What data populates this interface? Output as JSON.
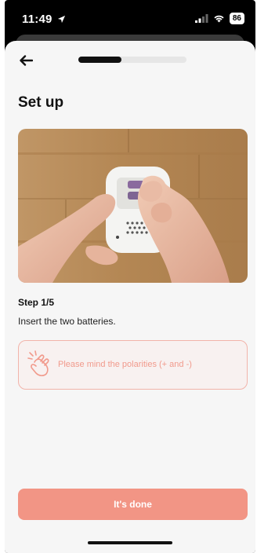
{
  "status_bar": {
    "time": "11:49",
    "battery": "86",
    "icons": [
      "location-arrow-icon",
      "cellular-signal-icon",
      "wifi-icon",
      "battery-icon"
    ]
  },
  "header": {
    "back_icon": "arrow-left-icon",
    "progress_fraction": 0.4
  },
  "page": {
    "title": "Set up",
    "image_alt": "Hands inserting batteries into a white device"
  },
  "step": {
    "label": "Step 1/5",
    "description": "Insert the two batteries."
  },
  "tip": {
    "icon": "snapping-fingers-icon",
    "text": "Please mind the polarities (+ and -)"
  },
  "actions": {
    "done_label": "It's done"
  },
  "colors": {
    "accent": "#f29585",
    "tip_border": "#f2b4aa",
    "tip_text": "#f19a8c",
    "progress": "#111111",
    "background": "#f6f6f6"
  }
}
